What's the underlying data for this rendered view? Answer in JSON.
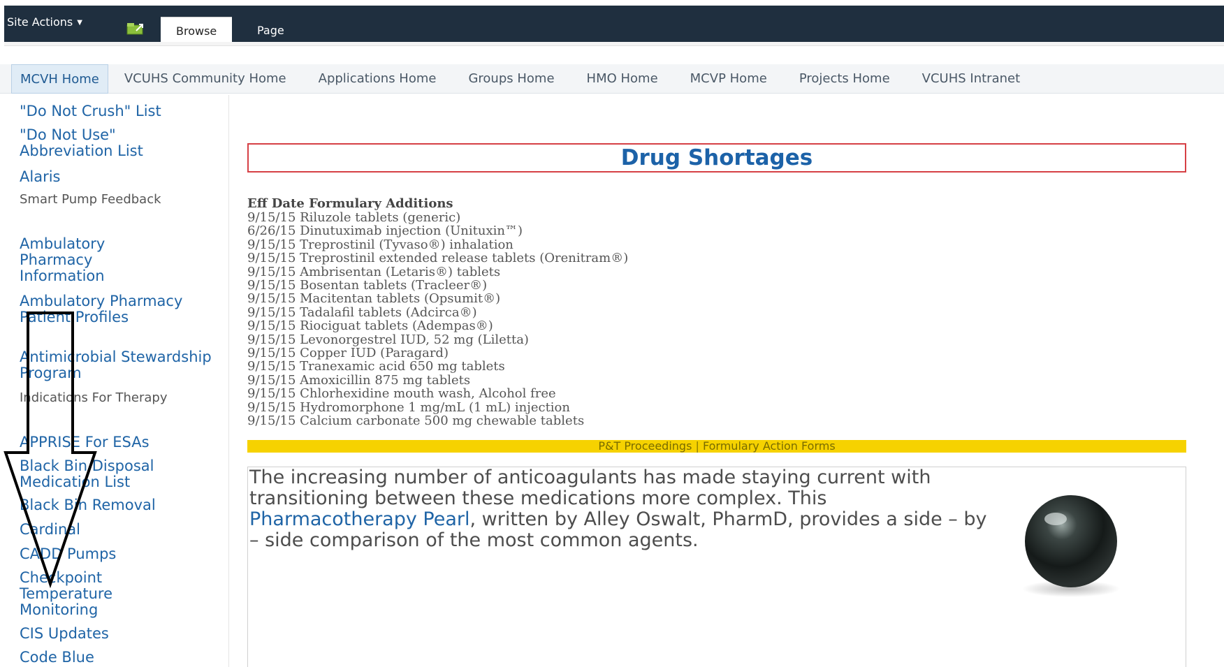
{
  "ribbon": {
    "site_actions": "Site Actions",
    "tabs": [
      {
        "label": "Browse"
      },
      {
        "label": "Page"
      }
    ]
  },
  "topnav": {
    "items": [
      "MCVH Home",
      "VCUHS Community Home",
      "Applications Home",
      "Groups Home",
      "HMO Home",
      "MCVP Home",
      "Projects Home",
      "VCUHS Intranet"
    ]
  },
  "leftnav": {
    "items": [
      "\"Do Not Crush\" List",
      "\"Do Not Use\" Abbreviation List",
      "Alaris",
      "Smart Pump Feedback",
      "Ambulatory Pharmacy Information",
      "Ambulatory Pharmacy Patient Profiles",
      "Antimicrobial Stewardship Program",
      "Indications For Therapy",
      "APPRISE For ESAs",
      "Black Bin Disposal Medication List",
      "Black Bin Removal",
      "Cardinal",
      "CADD Pumps",
      "Checkpoint Temperature Monitoring",
      "CIS Updates",
      "Code Blue"
    ]
  },
  "main": {
    "title": "Drug Shortages",
    "additions_header": "Eff Date Formulary Additions",
    "additions": [
      "9/15/15 Riluzole tablets (generic)",
      "6/26/15 Dinutuximab injection (Unituxin™)",
      "9/15/15 Treprostinil (Tyvaso®) inhalation",
      "9/15/15 Treprostinil extended release tablets (Orenitram®)",
      "9/15/15 Ambrisentan (Letaris®) tablets",
      "9/15/15 Bosentan tablets (Tracleer®)",
      "9/15/15 Macitentan tablets (Opsumit®)",
      "9/15/15 Tadalafil tablets (Adcirca®)",
      "9/15/15 Riociguat tablets (Adempas®)",
      "9/15/15 Levonorgestrel IUD, 52 mg (Liletta)",
      "9/15/15 Copper IUD (Paragard)",
      "9/15/15 Tranexamic acid 650 mg tablets",
      "9/15/15 Amoxicillin 875 mg tablets",
      "9/15/15 Chlorhexidine mouth wash, Alcohol free",
      "9/15/15 Hydromorphone 1 mg/mL (1 mL) injection",
      "9/15/15 Calcium carbonate 500 mg chewable tablets"
    ],
    "links": {
      "pt_proceedings": "P&T Proceedings",
      "separator": "|",
      "formulary_forms": "Formulary Action Forms"
    },
    "pearl": {
      "text_before": "The increasing number of anticoagulants has made staying current with transitioning between these medications more complex. This ",
      "link": "Pharmacotherapy Pearl",
      "text_after": ", written by Alley Oswalt, PharmD, provides a side – by – side comparison of the most common agents."
    }
  },
  "colors": {
    "ribbon_bg": "#1f2f3f",
    "link_blue": "#1f64a6",
    "title_blue": "#1c62a8",
    "title_border": "#d64045",
    "yellow_bar": "#f6d200"
  }
}
